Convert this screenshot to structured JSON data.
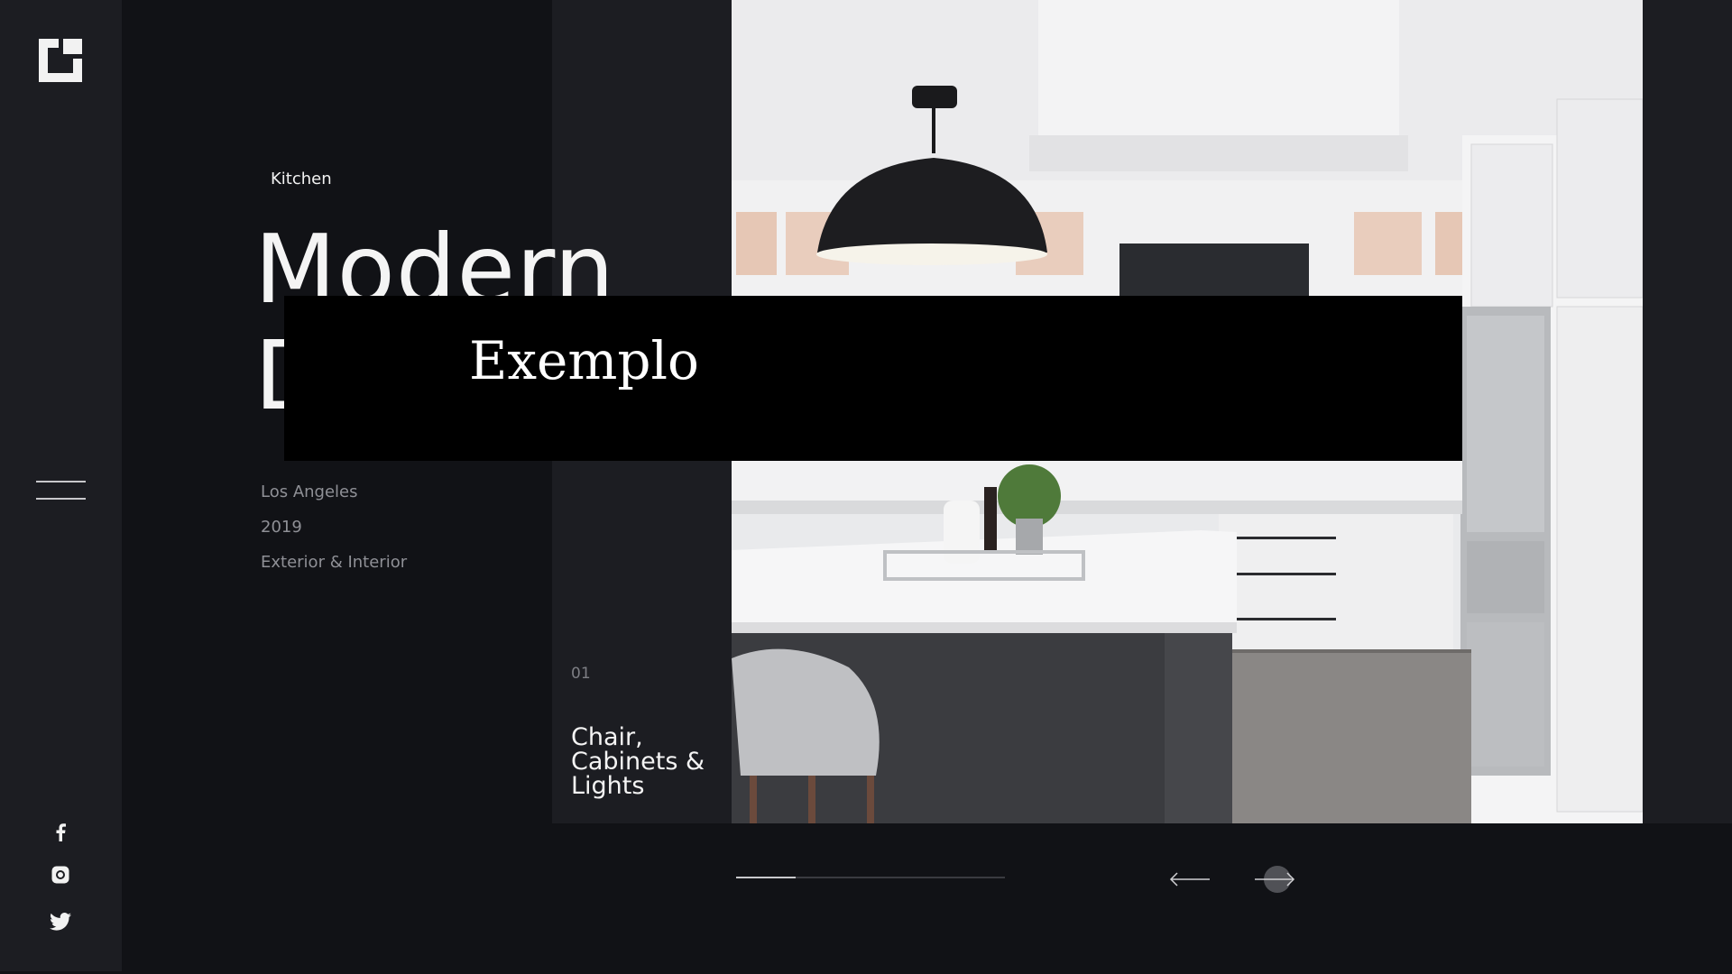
{
  "brand": {
    "logo_icon": "square-bracket-logo-icon"
  },
  "hero": {
    "category": "Kitchen",
    "title_line1": "Modern",
    "title_line2": "D"
  },
  "project_meta": {
    "location": "Los Angeles",
    "year": "2019",
    "scope": "Exterior & Interior"
  },
  "slide": {
    "number": "01",
    "caption_lines": [
      "Chair,",
      "Cabinets &",
      "Lights"
    ],
    "progress": 0.22
  },
  "overlay": {
    "text": "Exemplo"
  },
  "social": [
    "facebook-icon",
    "instagram-icon",
    "twitter-icon"
  ],
  "colors": {
    "bg_dark": "#111216",
    "panel": "#1c1d22",
    "text_muted": "#8f9096",
    "text_light": "#f4f4f4"
  }
}
